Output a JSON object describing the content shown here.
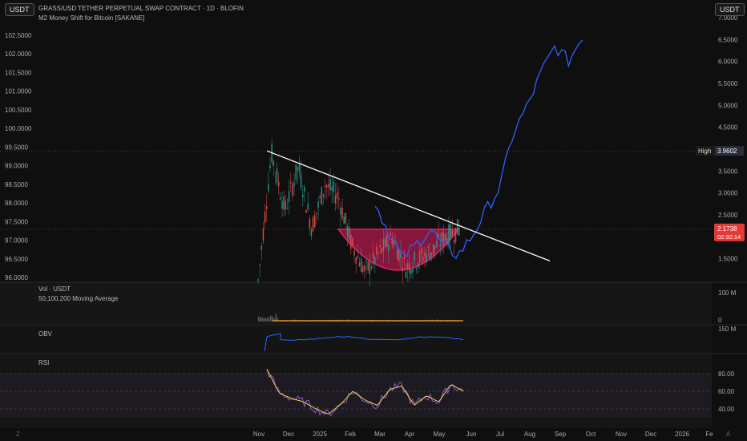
{
  "header": {
    "currency_left": "USDT",
    "currency_right": "USDT",
    "title": "GRASS/USD TETHER PERPETUAL SWAP CONTRACT · 1D · BLOFIN",
    "indicator": "M2 Money Shift for Bitcoin [SAKANE]"
  },
  "markers": {
    "high_label": "High",
    "high_value": "3.9602",
    "last_price": "2.1738",
    "countdown": "02:32:14"
  },
  "panes": {
    "vol_label": "Vol · USDT",
    "ma_label": "50,100,200 Moving Average",
    "obv_label": "OBV",
    "rsi_label": "RSI",
    "vol_ticks": [
      "100 M",
      "0"
    ],
    "obv_tick": "150 M",
    "rsi_ticks": [
      "80.00",
      "60.00",
      "40.00"
    ]
  },
  "colors": {
    "m2_line": "#2962ff",
    "trendline": "#ffffff",
    "cup_fill": "#e91e63",
    "rsi_line": "#7e57c2",
    "rsi_ma": "#f9d342",
    "obv_line": "#2962ff",
    "up": "#26a69a",
    "down": "#ef5350"
  },
  "bottom_icons": {
    "left": "Z",
    "right": "A"
  },
  "chart_data": {
    "type": "line",
    "left_axis": [
      "102.5000",
      "102.0000",
      "101.5000",
      "101.0000",
      "100.5000",
      "100.0000",
      "99.5000",
      "99.0000",
      "98.5000",
      "98.0000",
      "97.5000",
      "97.0000",
      "96.5000",
      "96.0000"
    ],
    "right_axis": [
      "7.0000",
      "6.5000",
      "6.0000",
      "5.5000",
      "5.0000",
      "4.5000",
      "4.0000",
      "3.5000",
      "3.0000",
      "2.5000",
      "2.0000",
      "1.5000"
    ],
    "x_ticks": [
      "Nov",
      "Dec",
      "2025",
      "Feb",
      "Mar",
      "Apr",
      "May",
      "Jun",
      "Jul",
      "Aug",
      "Sep",
      "Oct",
      "Nov",
      "Dec",
      "2026",
      "Fe"
    ],
    "price": {
      "high": 3.9602,
      "last": 2.1738,
      "approx_path": [
        1.0,
        3.9,
        2.6,
        3.6,
        2.2,
        3.2,
        2.9,
        1.8,
        1.2,
        1.6,
        2.0,
        1.3,
        1.5,
        1.7,
        2.0,
        2.1738
      ]
    },
    "m2": {
      "name": "M2 Money Shift for Bitcoin [SAKANE]",
      "approx_path": [
        98.0,
        97.2,
        96.5,
        96.9,
        97.3,
        96.8,
        96.6,
        97.1,
        97.8,
        98.4,
        99.9,
        100.6,
        101.5,
        102.2,
        101.8,
        102.5
      ]
    },
    "trendline": {
      "start": 3.9,
      "end": 1.45
    },
    "rsi": {
      "ticks": [
        80,
        60,
        40
      ],
      "approx_path": [
        85,
        58,
        52,
        48,
        40,
        34,
        45,
        60,
        50,
        44,
        62,
        66,
        44,
        55,
        48,
        68,
        60
      ]
    }
  }
}
